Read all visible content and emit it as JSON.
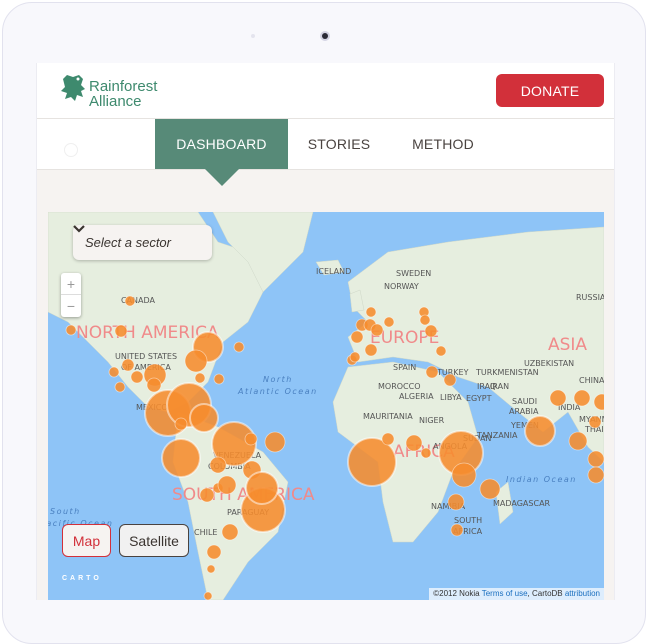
{
  "header": {
    "logo_line1": "Rainforest",
    "logo_line2": "Alliance",
    "donate_label": "DONATE"
  },
  "nav": {
    "tabs": [
      {
        "label": "DASHBOARD",
        "active": true
      },
      {
        "label": "STORIES",
        "active": false
      },
      {
        "label": "METHOD",
        "active": false
      }
    ]
  },
  "map": {
    "sector_select": {
      "placeholder": "Select a sector",
      "icon": "chevron-down-icon"
    },
    "zoom_in": "+",
    "zoom_out": "−",
    "basemap_buttons": [
      {
        "label": "Map",
        "active": true
      },
      {
        "label": "Satellite",
        "active": false
      }
    ],
    "carto_logo": "CARTO",
    "attribution": {
      "text": "©2012 Nokia ",
      "terms_link": "Terms of use",
      "middle": ", CartoDB ",
      "attribution_link": "attribution"
    },
    "region_labels": [
      "NORTH AMERICA",
      "EUROPE",
      "ASIA",
      "AFRICA",
      "SOUTH AMERICA"
    ],
    "country_labels": [
      "CANADA",
      "ICELAND",
      "SWEDEN",
      "NORWAY",
      "RUSSIA",
      "UNITED STATES",
      "OF AMERICA",
      "MEXICO",
      "VENEZUELA",
      "COLOMBIA",
      "PARAGUAY",
      "CHILE",
      "SPAIN",
      "MOROCCO",
      "ALGERIA",
      "LIBYA",
      "EGYPT",
      "MAURITANIA",
      "NIGER",
      "SUDAN",
      "TURKEY",
      "TURKMENISTAN",
      "UZBEKISTAN",
      "IRAQ",
      "IRAN",
      "SAUDI",
      "ARABIA",
      "YEMEN",
      "ANGOLA",
      "TANZANIA",
      "NAMIBIA",
      "SOUTH",
      "AFRICA",
      "MADAGASCAR",
      "INDIA",
      "CHINA",
      "MYANMAR",
      "THAILAND"
    ],
    "ocean_labels": [
      "North",
      "Atlantic Ocean",
      "Indian Ocean",
      "South",
      "Pacific Ocean"
    ],
    "colors": {
      "accent": "#578a78",
      "donate": "#d2303a",
      "bubble": "#f68c2e",
      "water": "#8ec4f7",
      "land": "#e8efe2"
    }
  }
}
